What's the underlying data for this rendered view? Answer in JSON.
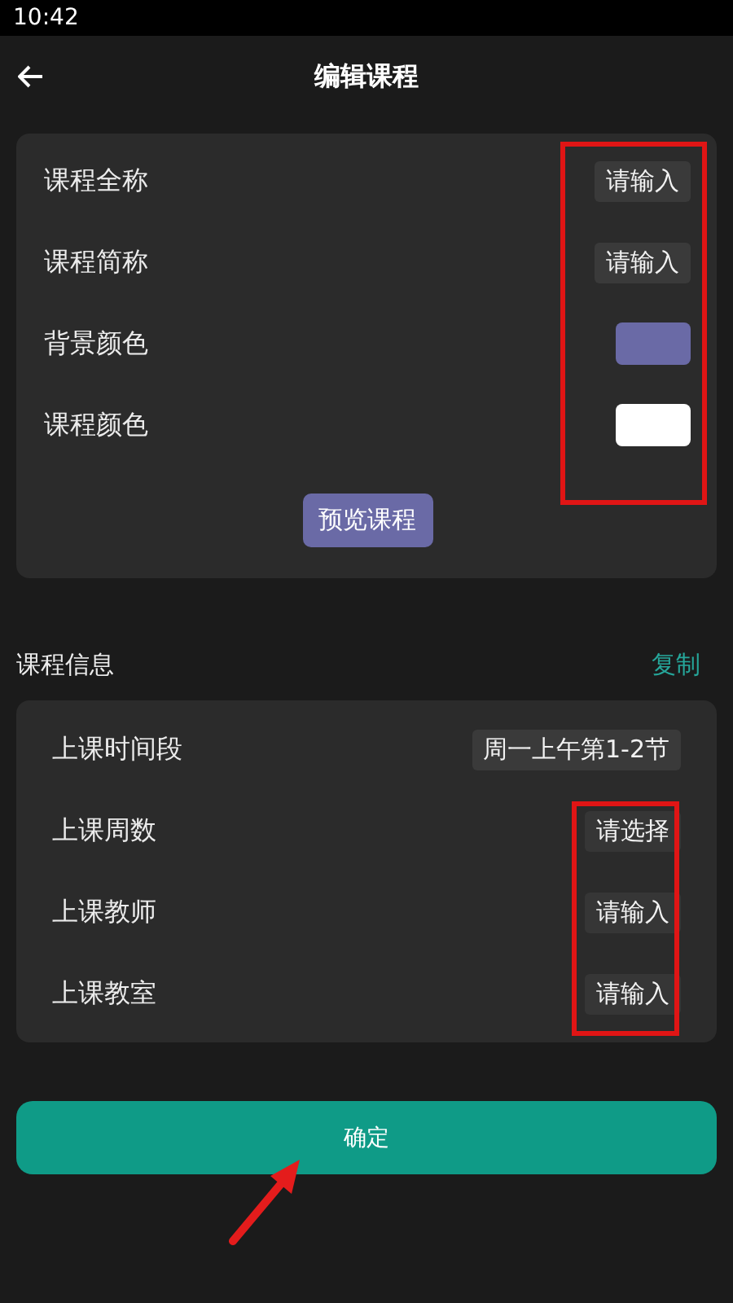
{
  "status_bar": {
    "time": "10:42"
  },
  "header": {
    "title": "编辑课程"
  },
  "course_card": {
    "highlighted": true,
    "rows": [
      {
        "label": "课程全称",
        "kind": "input",
        "value": "请输入"
      },
      {
        "label": "课程简称",
        "kind": "input",
        "value": "请输入"
      },
      {
        "label": "背景颜色",
        "kind": "color",
        "color": "#6a6aa6"
      },
      {
        "label": "课程颜色",
        "kind": "color",
        "color": "#ffffff"
      }
    ],
    "preview_button": "预览课程"
  },
  "info_section": {
    "title": "课程信息",
    "copy_link": "复制"
  },
  "info_card": {
    "rows": [
      {
        "label": "上课时间段",
        "value": "周一上午第1-2节",
        "highlighted": false
      },
      {
        "label": "上课周数",
        "value": "请选择",
        "highlighted": true
      },
      {
        "label": "上课教师",
        "value": "请输入",
        "highlighted": true
      },
      {
        "label": "上课教室",
        "value": "请输入",
        "highlighted": true
      }
    ]
  },
  "confirm_button": {
    "label": "确定",
    "arrow": true
  }
}
